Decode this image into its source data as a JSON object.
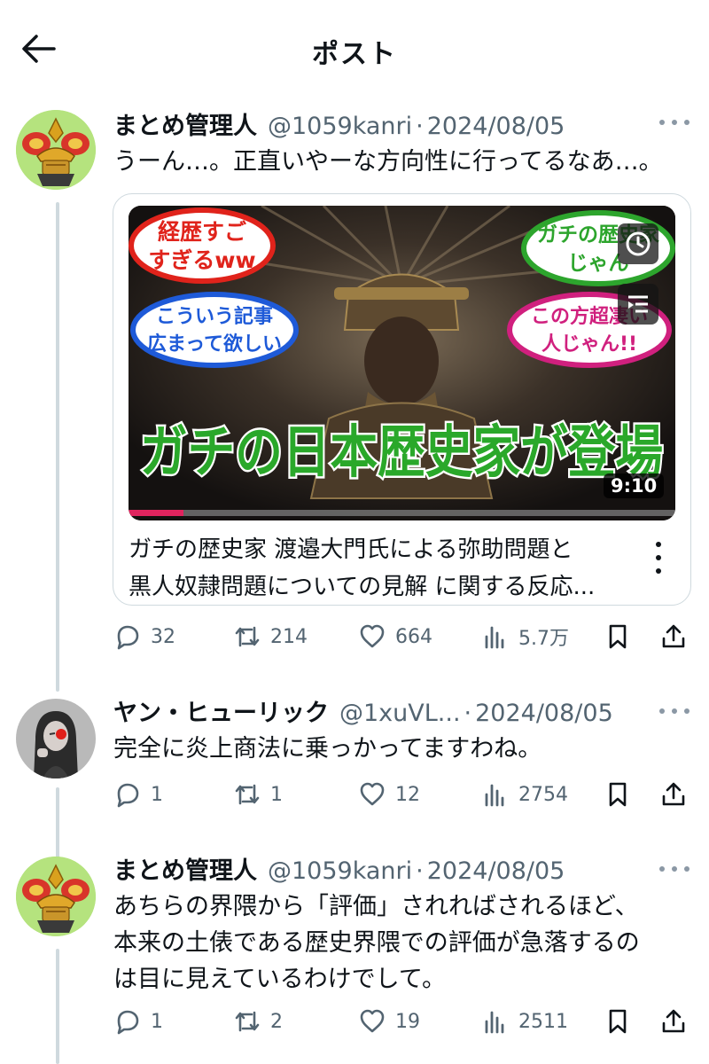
{
  "header": {
    "title": "ポスト"
  },
  "tweets": [
    {
      "name": "まとめ管理人",
      "handle": "@1059kanri",
      "date": "2024/08/05",
      "text": "うーん…。正直いやーな方向性に行ってるなあ…。",
      "card": {
        "thumbnail": {
          "bubble1": [
            "経歴すご",
            "すぎるww"
          ],
          "bubble2": [
            "ガチの歴史家",
            "じゃん"
          ],
          "bubble3": [
            "こういう記事",
            "広まって欲しい"
          ],
          "bubble4": [
            "この方超凄い",
            "人じゃん!!"
          ],
          "headline": "ガチの日本歴史家が登場",
          "duration": "9:10"
        },
        "title_line1": "ガチの歴史家 渡邉大門氏による弥助問題と",
        "title_line2": "黒人奴隷問題についての見解 に関する反応..."
      },
      "stats": {
        "replies": "32",
        "retweets": "214",
        "likes": "664",
        "views": "5.7万"
      }
    },
    {
      "name": "ヤン・ヒューリック",
      "handle": "@1xuVL...",
      "date": "2024/08/05",
      "text": "完全に炎上商法に乗っかってますわね。",
      "stats": {
        "replies": "1",
        "retweets": "1",
        "likes": "12",
        "views": "2754"
      }
    },
    {
      "name": "まとめ管理人",
      "handle": "@1059kanri",
      "date": "2024/08/05",
      "text_lines": [
        "あちらの界隈から「評価」されればされるほど、",
        "本来の土俵である歴史界隈での評価が急落するの",
        "は目に見えているわけでして。"
      ],
      "stats": {
        "replies": "1",
        "retweets": "2",
        "likes": "19",
        "views": "2511"
      }
    }
  ],
  "colors": {
    "text": "#0f1419",
    "secondary": "#536471",
    "thread_line": "#cfd9de",
    "progress": "#e0245e",
    "thumb_green": "#1f9c1f"
  },
  "icons": [
    "back-arrow-icon",
    "more-icon",
    "reply-icon",
    "retweet-icon",
    "like-icon",
    "views-icon",
    "bookmark-icon",
    "share-icon",
    "clock-icon",
    "playlist-icon"
  ]
}
